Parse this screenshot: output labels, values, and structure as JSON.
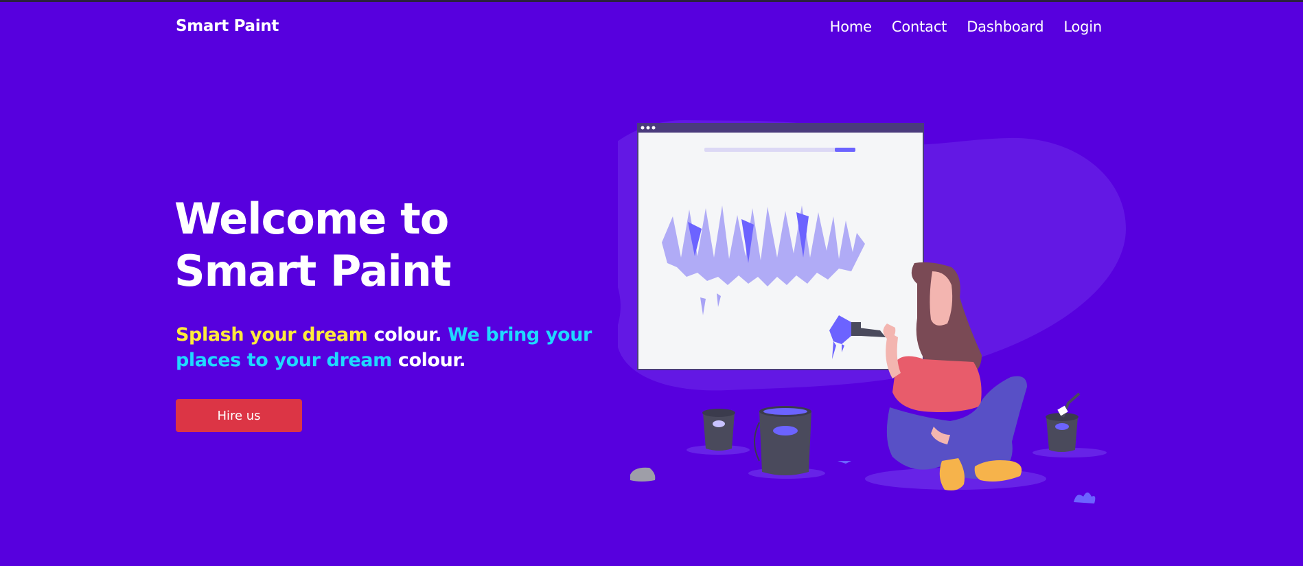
{
  "navbar": {
    "brand": "Smart Paint",
    "links": [
      "Home",
      "Contact",
      "Dashboard",
      "Login"
    ]
  },
  "hero": {
    "title_line1": "Welcome to",
    "title_line2": "Smart Paint",
    "tagline": [
      {
        "text": "Splash your dream ",
        "color": "#ffeb3b"
      },
      {
        "text": "colour. ",
        "color": "#ffffff"
      },
      {
        "text": "We bring your places to your dream ",
        "color": "#1fd9ff"
      },
      {
        "text": "colour.",
        "color": "#ffffff"
      }
    ],
    "cta_label": "Hire us"
  },
  "colors": {
    "background": "#5700de",
    "button": "#dc3545",
    "accent": "#6c63ff"
  },
  "illustration": {
    "description_icon": "woman-painting-canvas-illustration"
  }
}
